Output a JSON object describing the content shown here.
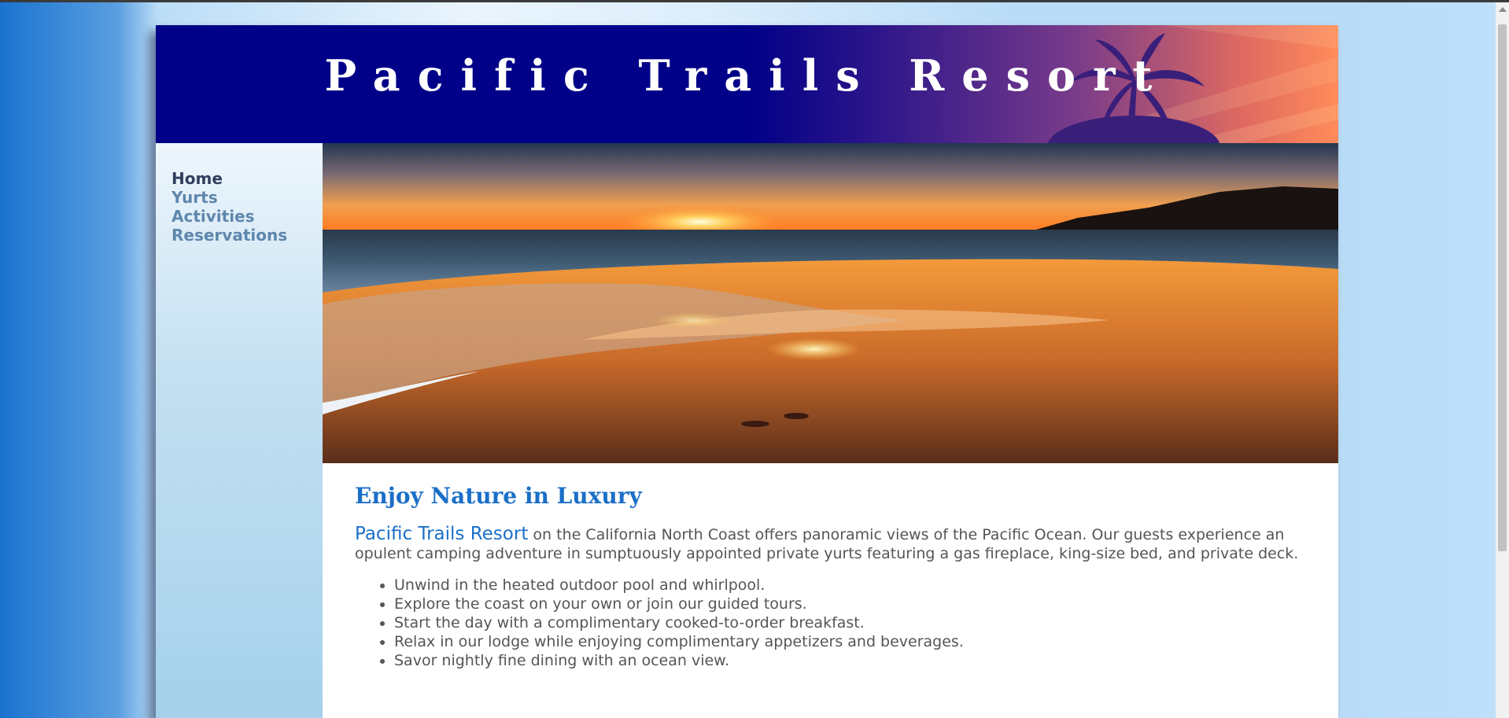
{
  "site": {
    "title": "Pacific Trails Resort"
  },
  "nav": {
    "items": [
      "Home",
      "Yurts",
      "Activities",
      "Reservations"
    ]
  },
  "main": {
    "heading": "Enjoy Nature in Luxury",
    "intro_highlight": "Pacific Trails Resort",
    "intro_rest": " on the California North Coast offers panoramic views of the Pacific Ocean. Our guests experience an opulent camping adventure in sumptuously appointed private yurts featuring a gas fireplace, king-size bed, and private deck.",
    "features": [
      "Unwind in the heated outdoor pool and whirlpool.",
      "Explore the coast on your own or join our guided tours.",
      "Start the day with a complimentary cooked-to-order breakfast.",
      "Relax in our lodge while enjoying complimentary appetizers and beverages.",
      "Savor nightly fine dining with an ocean view."
    ]
  },
  "colors": {
    "header_bg": "#000088",
    "heading": "#1b6fc8",
    "nav_active": "#2e3e5c",
    "nav_link": "#5f86ad"
  },
  "icons": {
    "header": "palm-tree-silhouette",
    "hero": "sunset-beach-photo"
  }
}
